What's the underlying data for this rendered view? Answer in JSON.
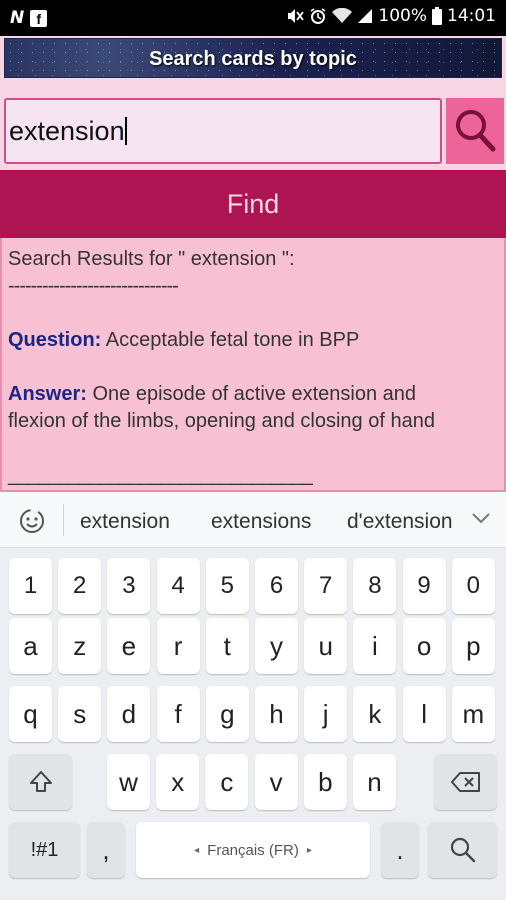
{
  "status_bar": {
    "left_icons": [
      "n-notification-icon",
      "facebook-icon"
    ],
    "battery": "100%",
    "time": "14:01",
    "icons": [
      "mute-icon",
      "alarm-icon",
      "wifi-icon",
      "signal-icon",
      "battery-icon"
    ]
  },
  "app": {
    "title": "Search cards by topic",
    "search": {
      "value": "extension",
      "button_icon": "search-icon"
    },
    "find_label": "Find",
    "results": {
      "header": "Search Results for \" extension \":",
      "separator": "------------------------------",
      "question_label": "Question:",
      "question": "Acceptable fetal tone in BPP",
      "answer_label": "Answer:",
      "answer_line1": "One episode of active extension and",
      "answer_line2": "flexion of the limbs, opening and closing of hand",
      "separator2": "______________________________"
    }
  },
  "keyboard": {
    "suggestions": [
      "extension",
      "extensions",
      "d'extension"
    ],
    "row_numbers": [
      "1",
      "2",
      "3",
      "4",
      "5",
      "6",
      "7",
      "8",
      "9",
      "0"
    ],
    "row1": [
      "a",
      "z",
      "e",
      "r",
      "t",
      "y",
      "u",
      "i",
      "o",
      "p"
    ],
    "row2": [
      "q",
      "s",
      "d",
      "f",
      "g",
      "h",
      "j",
      "k",
      "l",
      "m"
    ],
    "row3": [
      "w",
      "x",
      "c",
      "v",
      "b",
      "n"
    ],
    "sym_label": "!#1",
    "comma_label": ",",
    "space_label": "Français (FR)",
    "period_label": "."
  },
  "colors": {
    "accent": "#ad1451",
    "search_button": "#ed6498",
    "results_bg": "#f8c1d3",
    "label_blue": "#1b2586"
  }
}
